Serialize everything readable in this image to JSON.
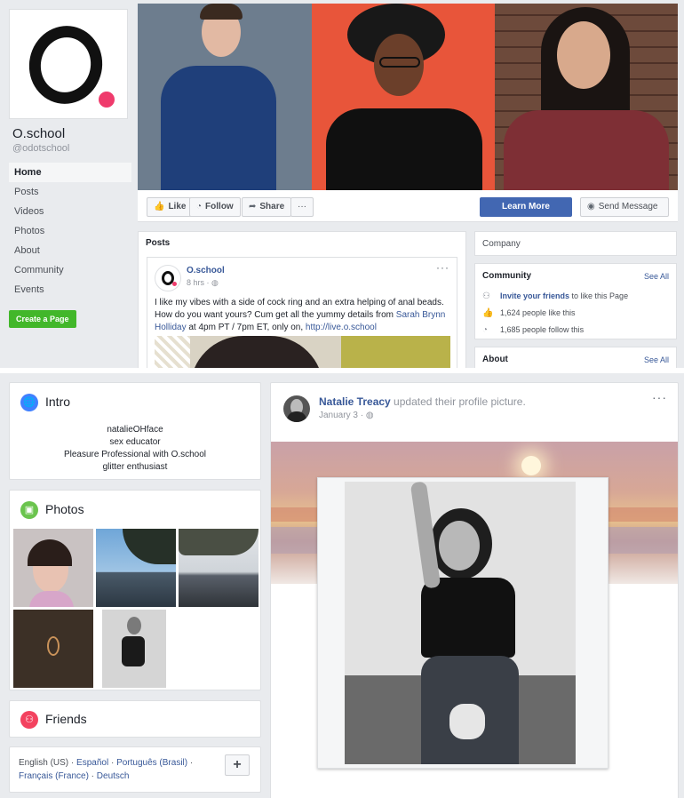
{
  "page": {
    "name": "O.school",
    "handle": "@odotschool",
    "nav": [
      "Home",
      "Posts",
      "Videos",
      "Photos",
      "About",
      "Community",
      "Events"
    ],
    "create_page": "Create a Page"
  },
  "actions": {
    "like": "Like",
    "follow": "Follow",
    "share": "Share",
    "more": "···",
    "learn_more": "Learn More",
    "send_message": "Send Message"
  },
  "posts": {
    "title": "Posts",
    "author": "O.school",
    "time": "8 hrs",
    "text_part1": "I like my vibes with a side of cock ring and an extra helping of anal beads. How do you want yours? Cum get all the yummy details from ",
    "mention": "Sarah Brynn Holliday",
    "text_part2": " at 4pm PT / 7pm ET, only on, ",
    "url": "http://live.o.school"
  },
  "sidebar": {
    "company": "Company",
    "community_title": "Community",
    "see_all": "See All",
    "invite_link": "Invite your friends",
    "invite_rest": " to like this Page",
    "likes": "1,624 people like this",
    "follows": "1,685 people follow this",
    "about_title": "About"
  },
  "intro": {
    "title": "Intro",
    "lines": [
      "natalieOHface",
      "sex educator",
      "Pleasure Professional with O.school",
      "glitter enthusiast"
    ]
  },
  "photos": {
    "title": "Photos"
  },
  "friends": {
    "title": "Friends"
  },
  "languages": {
    "current": "English (US)",
    "others": [
      "Español",
      "Português (Brasil)",
      "Français (France)",
      "Deutsch"
    ],
    "sep": " · ",
    "add": "+"
  },
  "feed": {
    "name": "Natalie Treacy",
    "action": " updated their profile picture.",
    "date": "January 3",
    "more": "···"
  },
  "icons": {
    "intro": "globe-icon",
    "photos": "photo-icon",
    "friends": "friends-icon"
  },
  "colors": {
    "brand_blue": "#4267b2",
    "link": "#385898",
    "create_green": "#42b72a",
    "logo_pink": "#ef3b6c",
    "intro_icon": "#4080ff",
    "photos_icon": "#6bc44e",
    "friends_icon": "#f3425f"
  }
}
